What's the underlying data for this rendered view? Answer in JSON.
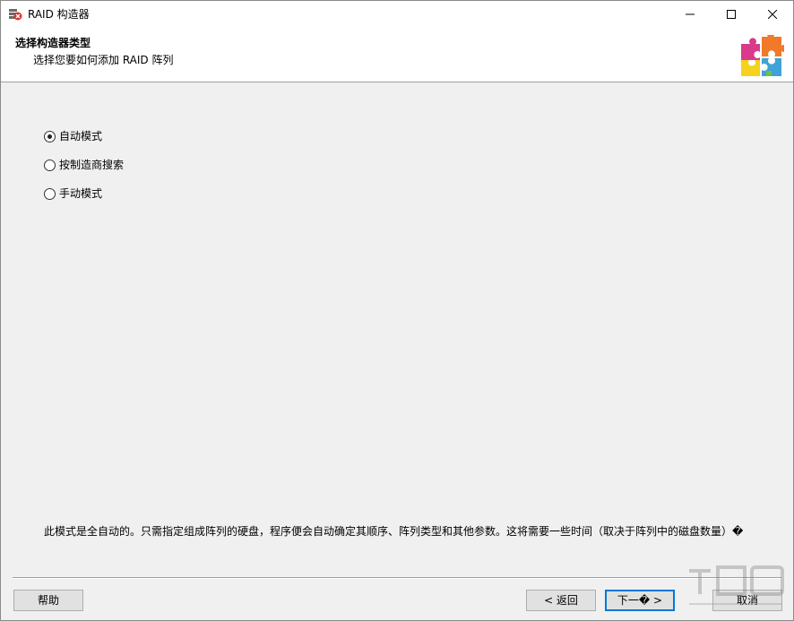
{
  "window": {
    "title": "RAID 构造器",
    "icon": "raid-app-icon"
  },
  "header": {
    "title": "选择构造器类型",
    "subtitle": "选择您要如何添加 RAID 阵列",
    "icon": "puzzle-icon"
  },
  "options": [
    {
      "label": "自动模式",
      "checked": true
    },
    {
      "label": "按制造商搜索",
      "checked": false
    },
    {
      "label": "手动模式",
      "checked": false
    }
  ],
  "description": "此模式是全自动的。只需指定组成阵列的硬盘，程序便会自动确定其顺序、阵列类型和其他参数。这将需要一些时间（取决于阵列中的磁盘数量）�",
  "buttons": {
    "help": "帮助",
    "back": "< 返回",
    "next": "下一� >",
    "cancel": "取消"
  },
  "colors": {
    "accent": "#0078d7",
    "background": "#f0f0f0"
  }
}
